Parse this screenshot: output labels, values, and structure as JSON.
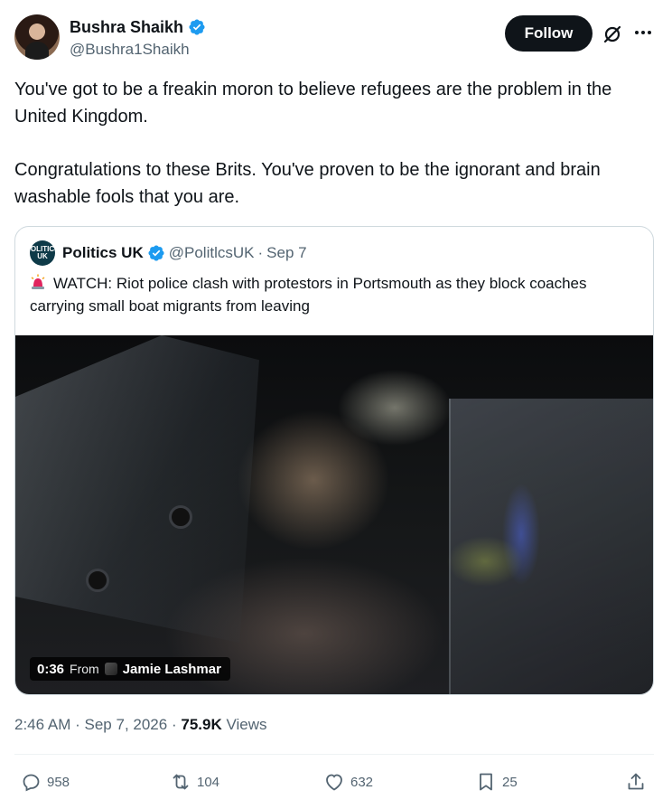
{
  "author": {
    "display_name": "Bushra Shaikh",
    "handle": "@Bushra1Shaikh"
  },
  "header": {
    "follow_label": "Follow"
  },
  "tweet": {
    "paragraphs": [
      "You've got to be a freakin moron to believe refugees are the problem in the United Kingdom.",
      "Congratulations to these Brits. You've proven to be the ignorant and brain washable fools that you are."
    ]
  },
  "quote": {
    "avatar_text": "POLITICS UK",
    "display_name": "Politics UK",
    "handle": "@PolitlcsUK",
    "separator": "·",
    "date": "Sep 7",
    "text": "WATCH: Riot police clash with protestors in Portsmouth as they block coaches carrying small boat migrants from leaving",
    "media": {
      "duration": "0:36",
      "from_label": "From",
      "from_name": "Jamie Lashmar"
    }
  },
  "meta": {
    "time": "2:46 AM",
    "separator": "·",
    "date": "Sep 7, 2026",
    "views_count": "75.9K",
    "views_label": "Views"
  },
  "actions": {
    "replies": "958",
    "reposts": "104",
    "likes": "632",
    "bookmarks": "25"
  },
  "colors": {
    "verified": "#1d9bf0",
    "text_primary": "#0f1419",
    "text_secondary": "#536471",
    "border": "#cfd9de"
  },
  "icons": [
    "verified-badge-icon",
    "grok-icon",
    "more-icon",
    "siren-icon",
    "reply-icon",
    "repost-icon",
    "like-icon",
    "bookmark-icon",
    "share-icon"
  ]
}
